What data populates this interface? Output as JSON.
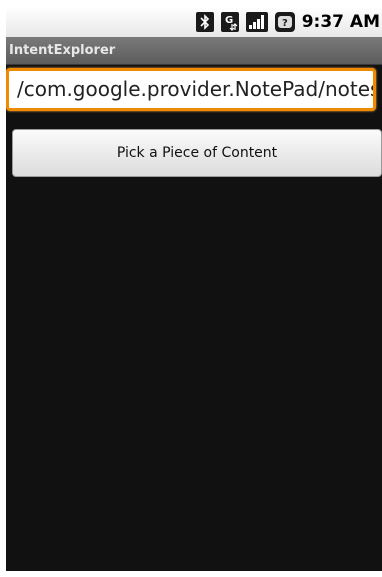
{
  "status_bar": {
    "time": "9:37 AM",
    "icons": [
      "bluetooth-icon",
      "data-sync-icon",
      "signal-icon",
      "sim-unknown-icon"
    ]
  },
  "app": {
    "title": "IntentExplorer"
  },
  "main": {
    "url_field_value": "/com.google.provider.NotePad/notes",
    "pick_button_label": "Pick a Piece of Content"
  },
  "colors": {
    "focus_accent": "#f08a00",
    "background": "#111111",
    "title_bar": "#6a6a6a"
  }
}
